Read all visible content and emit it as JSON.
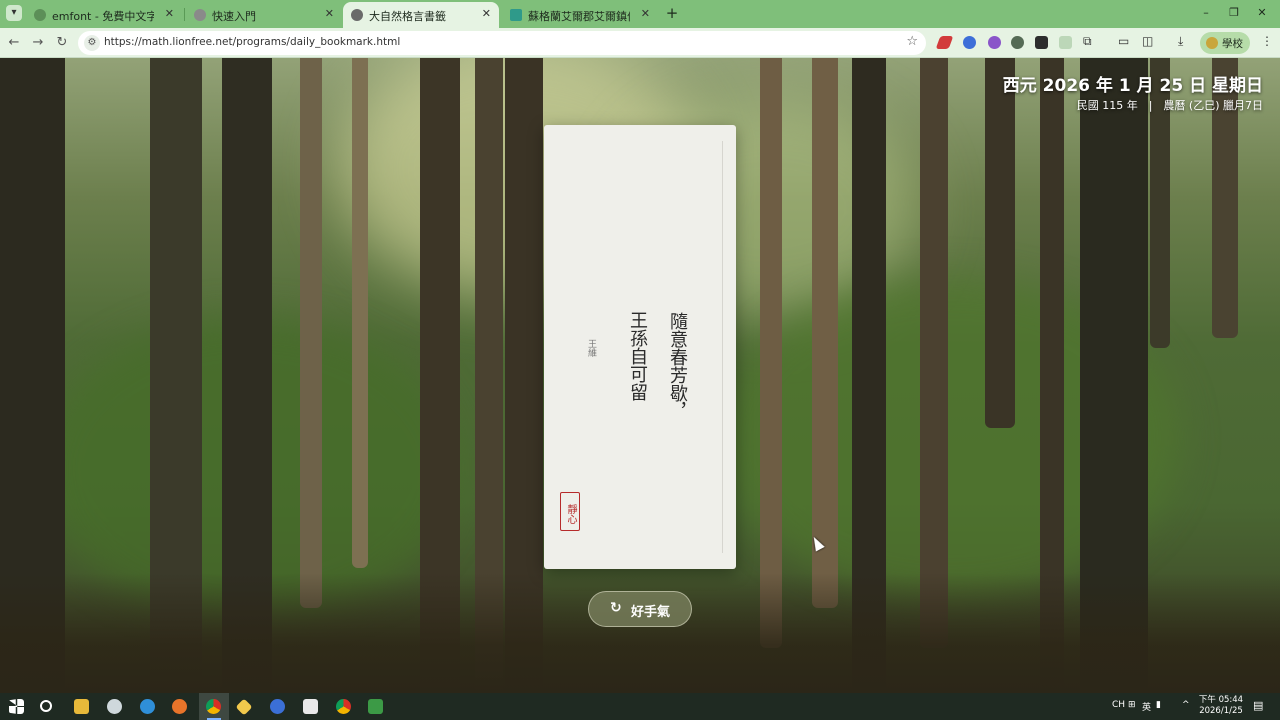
{
  "browser": {
    "tabs": [
      {
        "title": "emfont - 免費中文字體 Web",
        "active": false
      },
      {
        "title": "快速入門",
        "active": false
      },
      {
        "title": "大自然格言書籤",
        "active": true
      },
      {
        "title": "蘇格蘭艾爾郡艾爾鎮伯恩斯",
        "active": false
      }
    ],
    "tab_menu_icon": "chevron-down-icon",
    "new_tab_label": "+",
    "window_controls": {
      "minimize": "–",
      "maximize": "❐",
      "close": "✕"
    },
    "url": "https://math.lionfree.net/programs/daily_bookmark.html",
    "profile_label": "學校"
  },
  "page": {
    "date_main": "西元 2026 年 1 月 25 日 星期日",
    "date_sub": "民國 115 年　|　農曆 (乙巳) 臘月7日",
    "poem": {
      "col1": "隨意春芳歇，",
      "col2": "王孫自可留"
    },
    "author": "王維",
    "seal": "靜心",
    "button_label": "好手氣",
    "button_icon": "refresh-icon"
  },
  "taskbar": {
    "ime": [
      "CH",
      "英"
    ],
    "clock_time": "下午 05:44",
    "clock_date": "2026/1/25"
  },
  "colors": {
    "tab_strip": "#7fbf7a",
    "toolbar": "#e6f3e3",
    "seal_red": "#b62b2b",
    "card": "#efefea"
  }
}
